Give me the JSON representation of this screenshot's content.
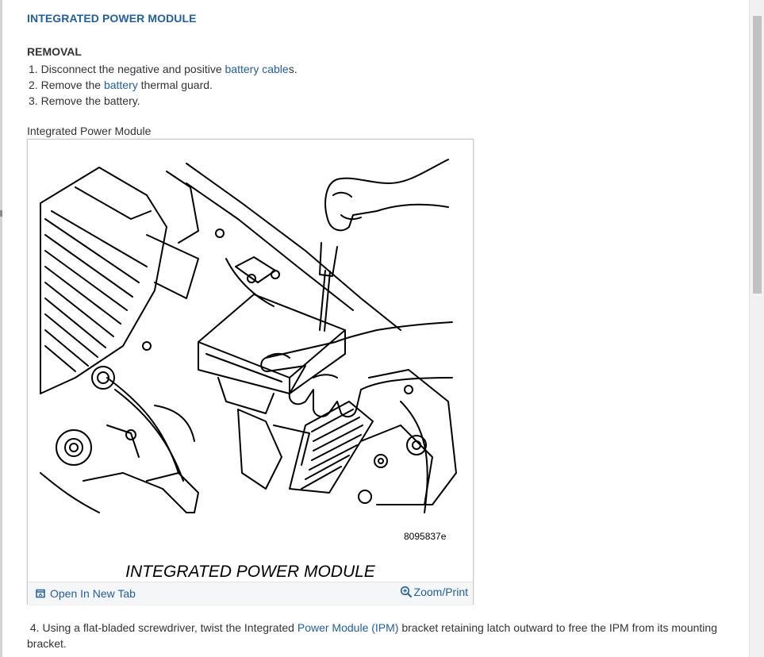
{
  "page": {
    "title": "INTEGRATED POWER MODULE",
    "section_heading": "REMOVAL"
  },
  "steps": [
    {
      "num": "1.",
      "before": "Disconnect the negative and positive ",
      "link": "battery cable",
      "after": "s."
    },
    {
      "num": "2.",
      "before": "Remove the ",
      "link": "battery",
      "after": " thermal guard."
    },
    {
      "num": "3.",
      "before": "Remove the battery.",
      "link": "",
      "after": ""
    }
  ],
  "figure": {
    "caption": "Integrated Power Module",
    "code": "8095837e",
    "label": "INTEGRATED POWER MODULE",
    "open_tab_label": "Open In New Tab",
    "zoom_label": "Zoom/Print",
    "icons": [
      "open-new-tab-icon",
      "zoom-icon"
    ]
  },
  "step4": {
    "num": "4.",
    "before": "Using a flat-bladed screwdriver, twist the Integrated ",
    "link": "Power Module (IPM)",
    "after": " bracket retaining latch outward to free the IPM from its mounting bracket."
  },
  "colors": {
    "link": "#1f5fa6",
    "text": "#333333",
    "figure_bar": "#f5f6f8"
  }
}
